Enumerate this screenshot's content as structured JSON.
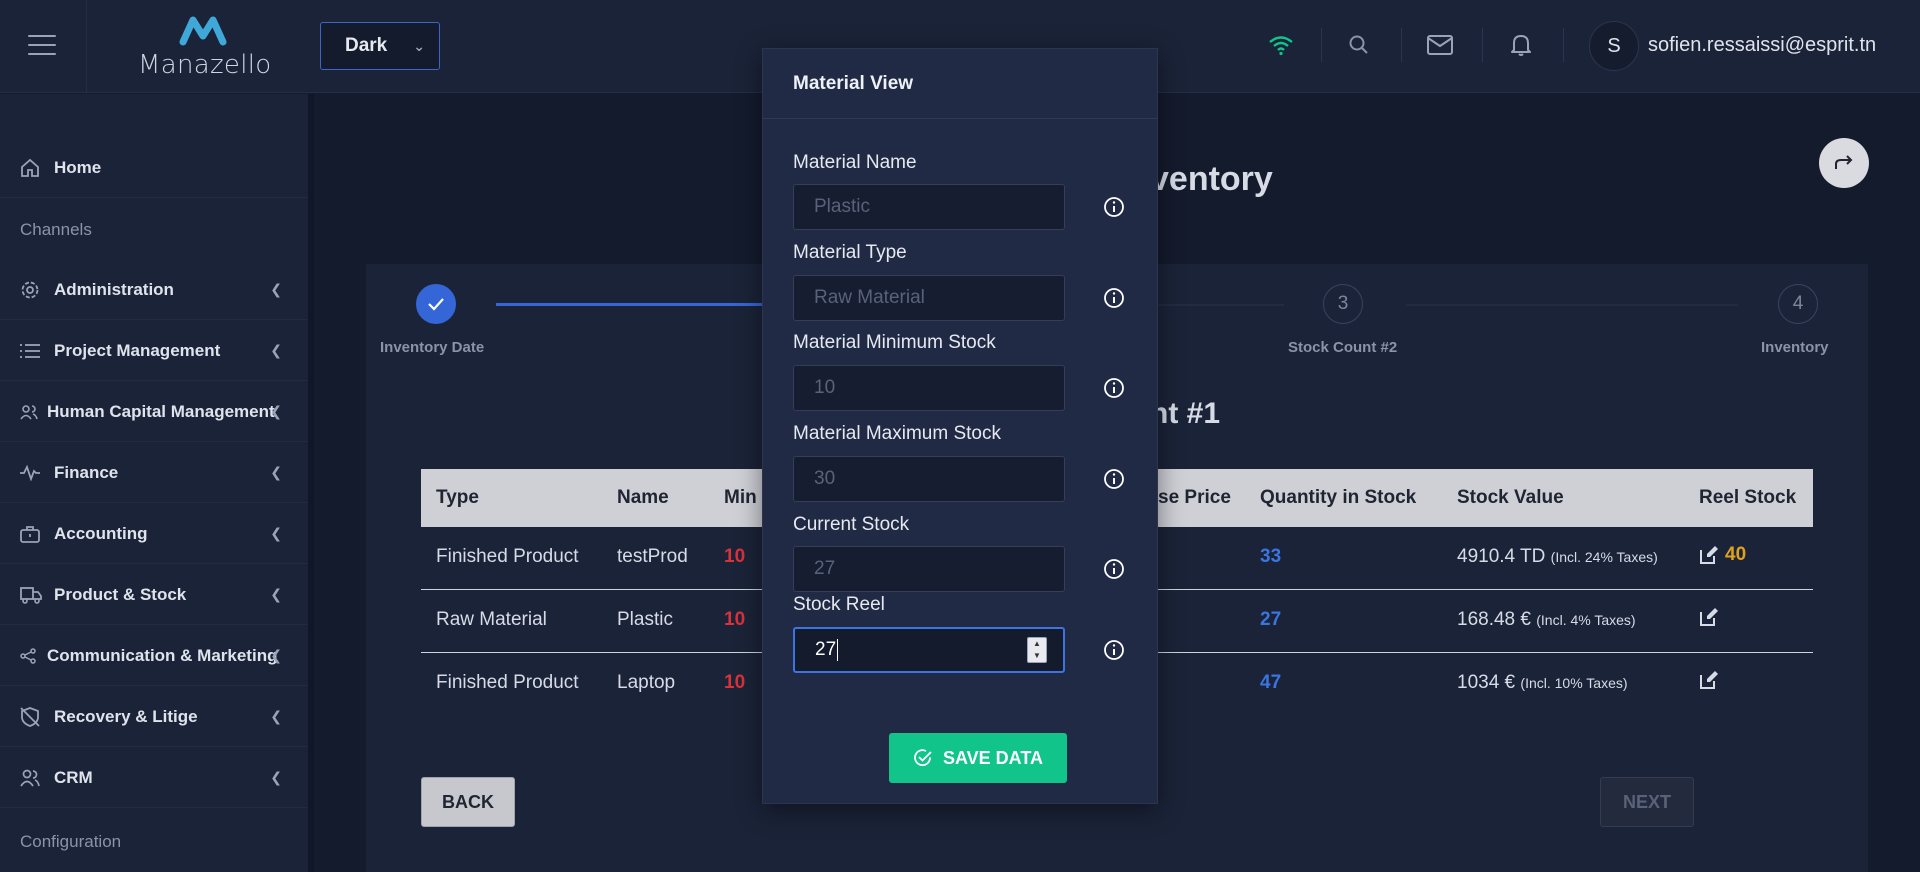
{
  "header": {
    "logo_text": "Manazello",
    "theme_value": "Dark",
    "user_initial": "S",
    "user_email": "sofien.ressaissi@esprit.tn",
    "colors": {
      "wifi": "#10c48a",
      "accent": "#3566d8"
    }
  },
  "sidebar": {
    "home": "Home",
    "channels": "Channels",
    "items": [
      {
        "label": "Administration",
        "icon": "gear-icon"
      },
      {
        "label": "Project Management",
        "icon": "list-icon"
      },
      {
        "label": "Human Capital Management",
        "icon": "users-icon"
      },
      {
        "label": "Finance",
        "icon": "pulse-icon"
      },
      {
        "label": "Accounting",
        "icon": "briefcase-icon"
      },
      {
        "label": "Product & Stock",
        "icon": "truck-icon"
      },
      {
        "label": "Communication & Marketing",
        "icon": "share-icon"
      },
      {
        "label": "Recovery & Litige",
        "icon": "shield-off-icon"
      },
      {
        "label": "CRM",
        "icon": "users-icon"
      }
    ],
    "configuration": "Configuration"
  },
  "main": {
    "title_partial": "ventory",
    "section_title_partial": "nt #1",
    "steps": [
      {
        "number": "",
        "label": "Inventory Date",
        "done": true
      },
      {
        "number": "3",
        "label": "Stock Count #2",
        "done": false
      },
      {
        "number": "4",
        "label": "Inventory",
        "done": false
      }
    ],
    "table": {
      "headers": {
        "type": "Type",
        "name": "Name",
        "min": "Min",
        "price": "se Price",
        "qty": "Quantity in Stock",
        "value": "Stock Value",
        "reel": "Reel Stock"
      },
      "rows": [
        {
          "type": "Finished Product",
          "name": "testProd",
          "min": "10",
          "qty": "33",
          "value": "4910.4 TD",
          "tax": "(Incl. 24% Taxes)",
          "reel": "40"
        },
        {
          "type": "Raw Material",
          "name": "Plastic",
          "min": "10",
          "qty": "27",
          "value": "168.48 €",
          "tax": "(Incl. 4% Taxes)",
          "reel": ""
        },
        {
          "type": "Finished Product",
          "name": "Laptop",
          "min": "10",
          "qty": "47",
          "value": "1034 €",
          "tax": "(Incl. 10% Taxes)",
          "reel": ""
        }
      ]
    },
    "back_label": "BACK",
    "next_label": "NEXT"
  },
  "modal": {
    "title": "Material View",
    "fields": [
      {
        "label": "Material Name",
        "value": "Plastic"
      },
      {
        "label": "Material Type",
        "value": "Raw Material"
      },
      {
        "label": "Material Minimum Stock",
        "value": "10"
      },
      {
        "label": "Material Maximum Stock",
        "value": "30"
      },
      {
        "label": "Current Stock",
        "value": "27"
      },
      {
        "label": "Stock Reel",
        "value": "27"
      }
    ],
    "save_label": "SAVE DATA"
  }
}
